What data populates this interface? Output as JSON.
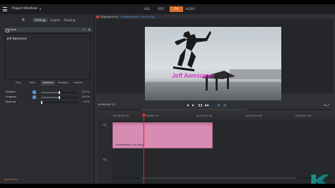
{
  "project": {
    "title": "Project title/text"
  },
  "tabs": [
    {
      "label": "LOG"
    },
    {
      "label": "EDIT"
    },
    {
      "label": "FX"
    },
    {
      "label": "AUDIO"
    }
  ],
  "left_panel": {
    "subtabs": [
      {
        "label": "Settings"
      },
      {
        "label": "Graphs"
      },
      {
        "label": "Routing"
      }
    ],
    "filter_header": "Clear",
    "text_value": "Jeff Awesome!",
    "text_tabs": [
      {
        "label": "Font"
      },
      {
        "label": "Face"
      },
      {
        "label": "Position"
      },
      {
        "label": "Shadow"
      },
      {
        "label": "Outline"
      }
    ],
    "params": [
      {
        "label": "Position",
        "value": "50.0%",
        "fraction": 0.5
      },
      {
        "label": "Progress",
        "value": "50.0%",
        "fraction": 0.5
      },
      {
        "label": "Spacing",
        "value": "0.0%",
        "fraction": 0.0
      }
    ],
    "keyframes_label": "Keyframes"
  },
  "viewer": {
    "sequence": "Sequence #1",
    "clip_name": "(Skateboarder_flip_temp)",
    "overlay_text": "Jeff Awesome!",
    "timecode": "00:00:00+13",
    "transport_icons": [
      "prev-frame-icon",
      "play-icon",
      "pause-icon",
      "next-frame-icon"
    ]
  },
  "timeline": {
    "ticks": [
      "00:00:00+00",
      "00:00:00+13",
      "00:00:01+00",
      "00:00:01+08",
      "00:00:02+00"
    ],
    "tracks": [
      {
        "label": "V1"
      },
      {
        "label": "A1"
      }
    ],
    "clip_label": "(Skateboarder_flip_temp)"
  },
  "colors": {
    "accent": "#d9702c",
    "playhead": "#d92a2a",
    "clip": "#d88bb3"
  }
}
